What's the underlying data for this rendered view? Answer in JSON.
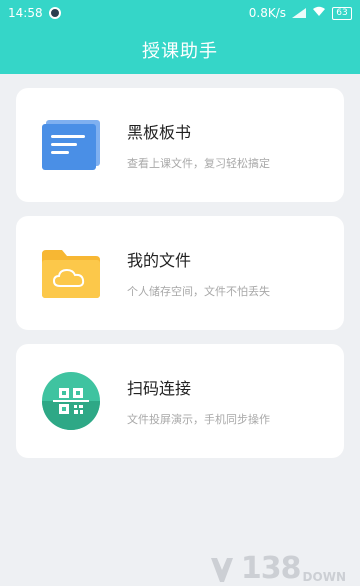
{
  "status_bar": {
    "time": "14:58",
    "speed": "0.8K/s",
    "battery": "63"
  },
  "app_bar": {
    "title": "授课助手"
  },
  "cards": [
    {
      "title": "黑板板书",
      "subtitle": "查看上课文件，复习轻松搞定",
      "icon": "document-icon",
      "color": "#4a90e2"
    },
    {
      "title": "我的文件",
      "subtitle": "个人储存空间，文件不怕丢失",
      "icon": "folder-cloud-icon",
      "color": "#fbc24a"
    },
    {
      "title": "扫码连接",
      "subtitle": "文件投屏演示，手机同步操作",
      "icon": "qr-scan-icon",
      "color": "#35b89a"
    }
  ],
  "watermark": {
    "number": "138",
    "suffix": "DOWN"
  }
}
